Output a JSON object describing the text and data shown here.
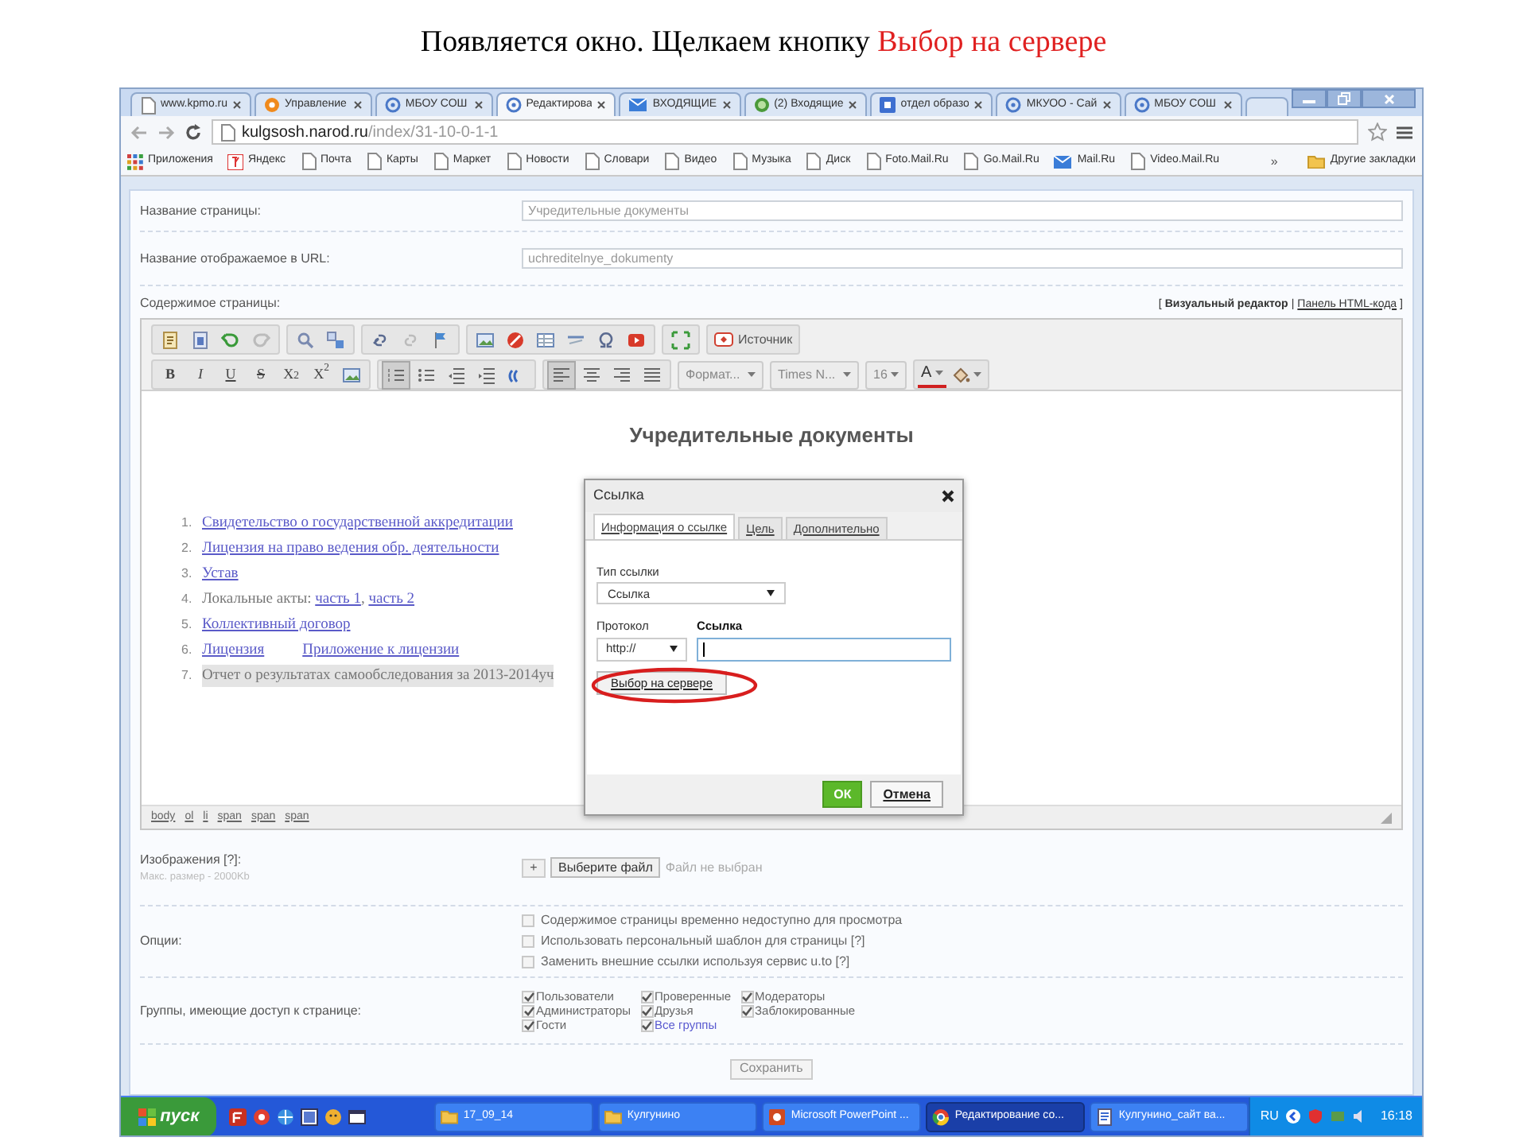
{
  "caption": {
    "text": "Появляется окно. Щелкаем кнопку",
    "highlight": "Выбор на сервере"
  },
  "browser": {
    "tabs": [
      {
        "label": "www.kpmo.ru",
        "kind": "page",
        "selected": false
      },
      {
        "label": "Управление",
        "kind": "round",
        "selected": false
      },
      {
        "label": "МБОУ СОШ",
        "kind": "ring",
        "selected": false
      },
      {
        "label": "Редактирова",
        "kind": "ring",
        "selected": true
      },
      {
        "label": "ВХОДЯЩИЕ",
        "kind": "mail",
        "selected": false
      },
      {
        "label": "(2) Входящие",
        "kind": "globe",
        "selected": false
      },
      {
        "label": "отдел образо",
        "kind": "square",
        "selected": false
      },
      {
        "label": "МКУОО - Сай",
        "kind": "ring",
        "selected": false
      },
      {
        "label": "МБОУ СОШ",
        "kind": "ring",
        "selected": false
      }
    ],
    "url": {
      "host": "kulgsosh.narod.ru",
      "path": "/index/31-10-0-1-1"
    },
    "bookmarks": [
      {
        "label": "Приложения",
        "kind": "apps"
      },
      {
        "label": "Яндекс",
        "kind": "yandex"
      },
      {
        "label": "Почта",
        "kind": "page"
      },
      {
        "label": "Карты",
        "kind": "page"
      },
      {
        "label": "Маркет",
        "kind": "page"
      },
      {
        "label": "Новости",
        "kind": "page"
      },
      {
        "label": "Словари",
        "kind": "page"
      },
      {
        "label": "Видео",
        "kind": "page"
      },
      {
        "label": "Музыка",
        "kind": "page"
      },
      {
        "label": "Диск",
        "kind": "page"
      },
      {
        "label": "Foto.Mail.Ru",
        "kind": "page"
      },
      {
        "label": "Go.Mail.Ru",
        "kind": "page"
      },
      {
        "label": "Mail.Ru",
        "kind": "mail"
      },
      {
        "label": "Video.Mail.Ru",
        "kind": "page"
      }
    ],
    "bookmarks_more": "»",
    "other_bookmarks": "Другие закладки"
  },
  "form": {
    "fields": [
      {
        "label": "Название страницы:",
        "value": "Учредительные документы"
      },
      {
        "label": "Название отображаемое в URL:",
        "value": "uchreditelnye_dokumenty"
      }
    ],
    "content_label": "Содержимое страницы:",
    "mode_switch": {
      "open": "[",
      "separator": "|",
      "close": "]",
      "modes": [
        {
          "label": "Визуальный редактор",
          "selected": true
        },
        {
          "label": "Панель HTML-кода",
          "selected": false
        }
      ]
    },
    "editor": {
      "source_button": "Источник",
      "text_buttons": [
        {
          "label": "B",
          "kind": "bold"
        },
        {
          "label": "I",
          "kind": "italic"
        },
        {
          "label": "U",
          "kind": "underline"
        },
        {
          "label": "S",
          "kind": "strike"
        },
        {
          "label": "X$_{2}$",
          "kind": "sub"
        },
        {
          "label": "X$^{2}$",
          "kind": "sup"
        }
      ],
      "list_buttons": [
        {
          "kind": "numbered",
          "selected": true
        },
        {
          "kind": "bulleted",
          "selected": false
        }
      ],
      "align_buttons": [
        {
          "kind": "left",
          "selected": true
        },
        {
          "kind": "center",
          "selected": false
        },
        {
          "kind": "right",
          "selected": false
        },
        {
          "kind": "justify",
          "selected": false
        }
      ],
      "dropdowns": [
        "Формат...",
        "Times N...",
        "16"
      ],
      "font_color_label": "A",
      "heading": "Учредительные документы",
      "items": [
        {
          "number": "1.",
          "parts": [
            {
              "text": "Свидетельство о государственной аккредитации",
              "link": true
            }
          ]
        },
        {
          "number": "2.",
          "parts": [
            {
              "text": "Лицензия на право ведения обр. деятельности",
              "link": true
            }
          ]
        },
        {
          "number": "3.",
          "parts": [
            {
              "text": "Устав",
              "link": true
            }
          ]
        },
        {
          "number": "4.",
          "parts": [
            {
              "text": "Локальные акты: ",
              "link": false
            },
            {
              "text": "часть 1",
              "link": true
            },
            {
              "text": ", ",
              "link": false
            },
            {
              "text": "часть 2",
              "link": true
            }
          ]
        },
        {
          "number": "5.",
          "parts": [
            {
              "text": "Коллективный договор",
              "link": true
            }
          ]
        },
        {
          "number": "6.",
          "parts": [
            {
              "text": "Лицензия",
              "link": true
            },
            {
              "text": "Приложение к лицензии",
              "link": true
            }
          ]
        },
        {
          "number": "7.",
          "selected": true,
          "parts": [
            {
              "text": "Отчет о результатах самообследования за 2013-2014уч",
              "link": false
            }
          ]
        }
      ],
      "path": [
        "body",
        "ol",
        "li",
        "span",
        "span",
        "span"
      ]
    },
    "dialog": {
      "title": "Ссылка",
      "tabs": [
        {
          "label": "Информация о ссылке",
          "selected": true
        },
        {
          "label": "Цель",
          "selected": false
        },
        {
          "label": "Дополнительно",
          "selected": false
        }
      ],
      "type_label": "Тип ссылки",
      "type_value": "Ссылка",
      "protocol_label": "Протокол",
      "protocol_value": "http://",
      "url_label": "Ссылка",
      "browse_button": "Выбор на сервере",
      "ok": "ОК",
      "cancel": "Отмена"
    },
    "images": {
      "label": "Изображения [?]:",
      "hint": "Макс. размер - 2000Kb",
      "add": "+",
      "choose": "Выберите файл",
      "status": "Файл не выбран"
    },
    "options": {
      "label": "Опции:",
      "items": [
        {
          "label": "Содержимое страницы временно недоступно для просмотра",
          "checked": false
        },
        {
          "label": "Использовать персональный шаблон для страницы [?]",
          "checked": false
        },
        {
          "label": "Заменить внешние ссылки используя сервис u.to [?]",
          "checked": false
        }
      ]
    },
    "groups": {
      "label": "Группы, имеющие доступ к странице:",
      "items": [
        {
          "label": "Пользователи",
          "checked": true,
          "kind": "plain"
        },
        {
          "label": "Администраторы",
          "checked": true,
          "kind": "plain"
        },
        {
          "label": "Гости",
          "checked": true,
          "kind": "plain"
        },
        {
          "label": "Проверенные",
          "checked": true,
          "kind": "plain"
        },
        {
          "label": "Друзья",
          "checked": true,
          "kind": "plain"
        },
        {
          "label": "Все группы",
          "checked": true,
          "kind": "link"
        },
        {
          "label": "Модераторы",
          "checked": true,
          "kind": "plain"
        },
        {
          "label": "Заблокированные",
          "checked": true,
          "kind": "plain"
        }
      ]
    },
    "save": "Сохранить"
  },
  "taskbar": {
    "start": "пуск",
    "tasks": [
      {
        "label": "17_09_14",
        "kind": "folder",
        "selected": false
      },
      {
        "label": "Кулгунино",
        "kind": "folder",
        "selected": false
      },
      {
        "label": "Microsoft PowerPoint ...",
        "kind": "slides",
        "selected": false
      },
      {
        "label": "Редактирование со...",
        "kind": "browser",
        "selected": true
      },
      {
        "label": "Кулгунино_сайт ва...",
        "kind": "document",
        "selected": false
      }
    ],
    "language": "RU",
    "clock": "16:18"
  }
}
